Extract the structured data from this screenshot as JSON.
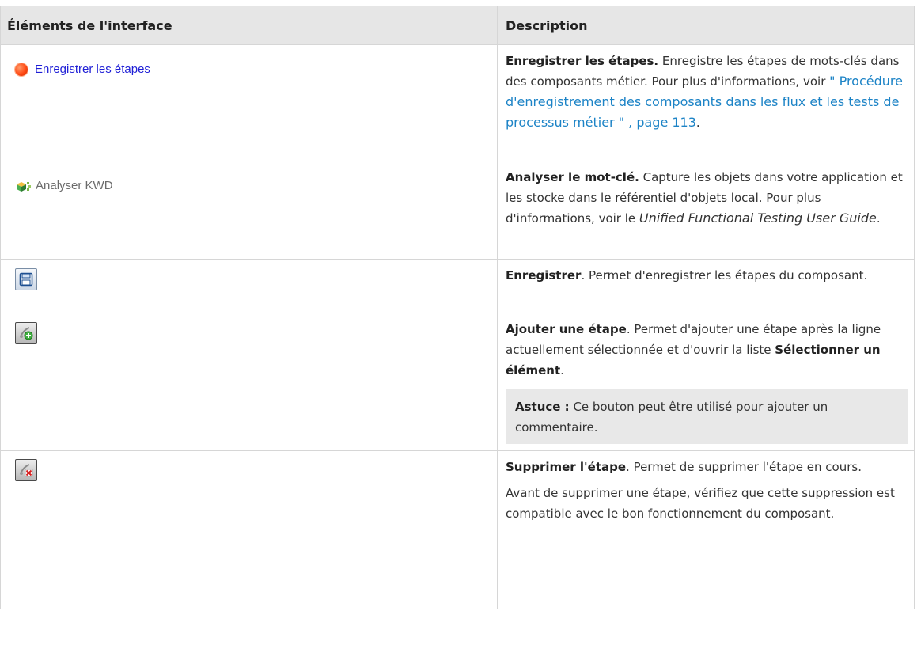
{
  "table": {
    "header": {
      "col1": "Éléments de l'interface",
      "col2": "Description"
    },
    "rows": [
      {
        "ui_label": "Enregistrer les étapes",
        "ui_icon": "record-icon",
        "desc_bold": "Enregistrer les étapes.",
        "desc_text": " Enregistre les étapes de mots-clés dans des composants métier. Pour plus d'informations, voir ",
        "desc_link": "\" Procédure d'enregistrement des composants dans les flux et les tests de processus métier \" , page 113",
        "desc_tail": "."
      },
      {
        "ui_label": "Analyser KWD",
        "ui_icon": "analyze-kwd-icon",
        "desc_bold": "Analyser le mot-clé.",
        "desc_text": " Capture les objets dans votre application et les stocke dans le référentiel d'objets local. Pour plus d'informations, voir le ",
        "desc_italic": "Unified Functional Testing User Guide",
        "desc_tail": "."
      },
      {
        "ui_icon": "save-icon",
        "desc_bold": "Enregistrer",
        "desc_text": ". Permet d'enregistrer les étapes du composant."
      },
      {
        "ui_icon": "add-step-icon",
        "desc_bold": "Ajouter une étape",
        "desc_text": ". Permet d'ajouter une étape après la ligne actuellement sélectionnée et d'ouvrir la liste ",
        "desc_bold2": "Sélectionner un élément",
        "desc_tail": ".",
        "tip_bold": "Astuce :",
        "tip_text": " Ce bouton peut être utilisé pour ajouter un commentaire."
      },
      {
        "ui_icon": "delete-step-icon",
        "desc_bold": "Supprimer l'étape",
        "desc_text": ". Permet de supprimer l'étape en cours.",
        "desc_para2": "Avant de supprimer une étape, vérifiez que cette suppression est compatible avec le bon fonctionnement du composant."
      }
    ]
  }
}
